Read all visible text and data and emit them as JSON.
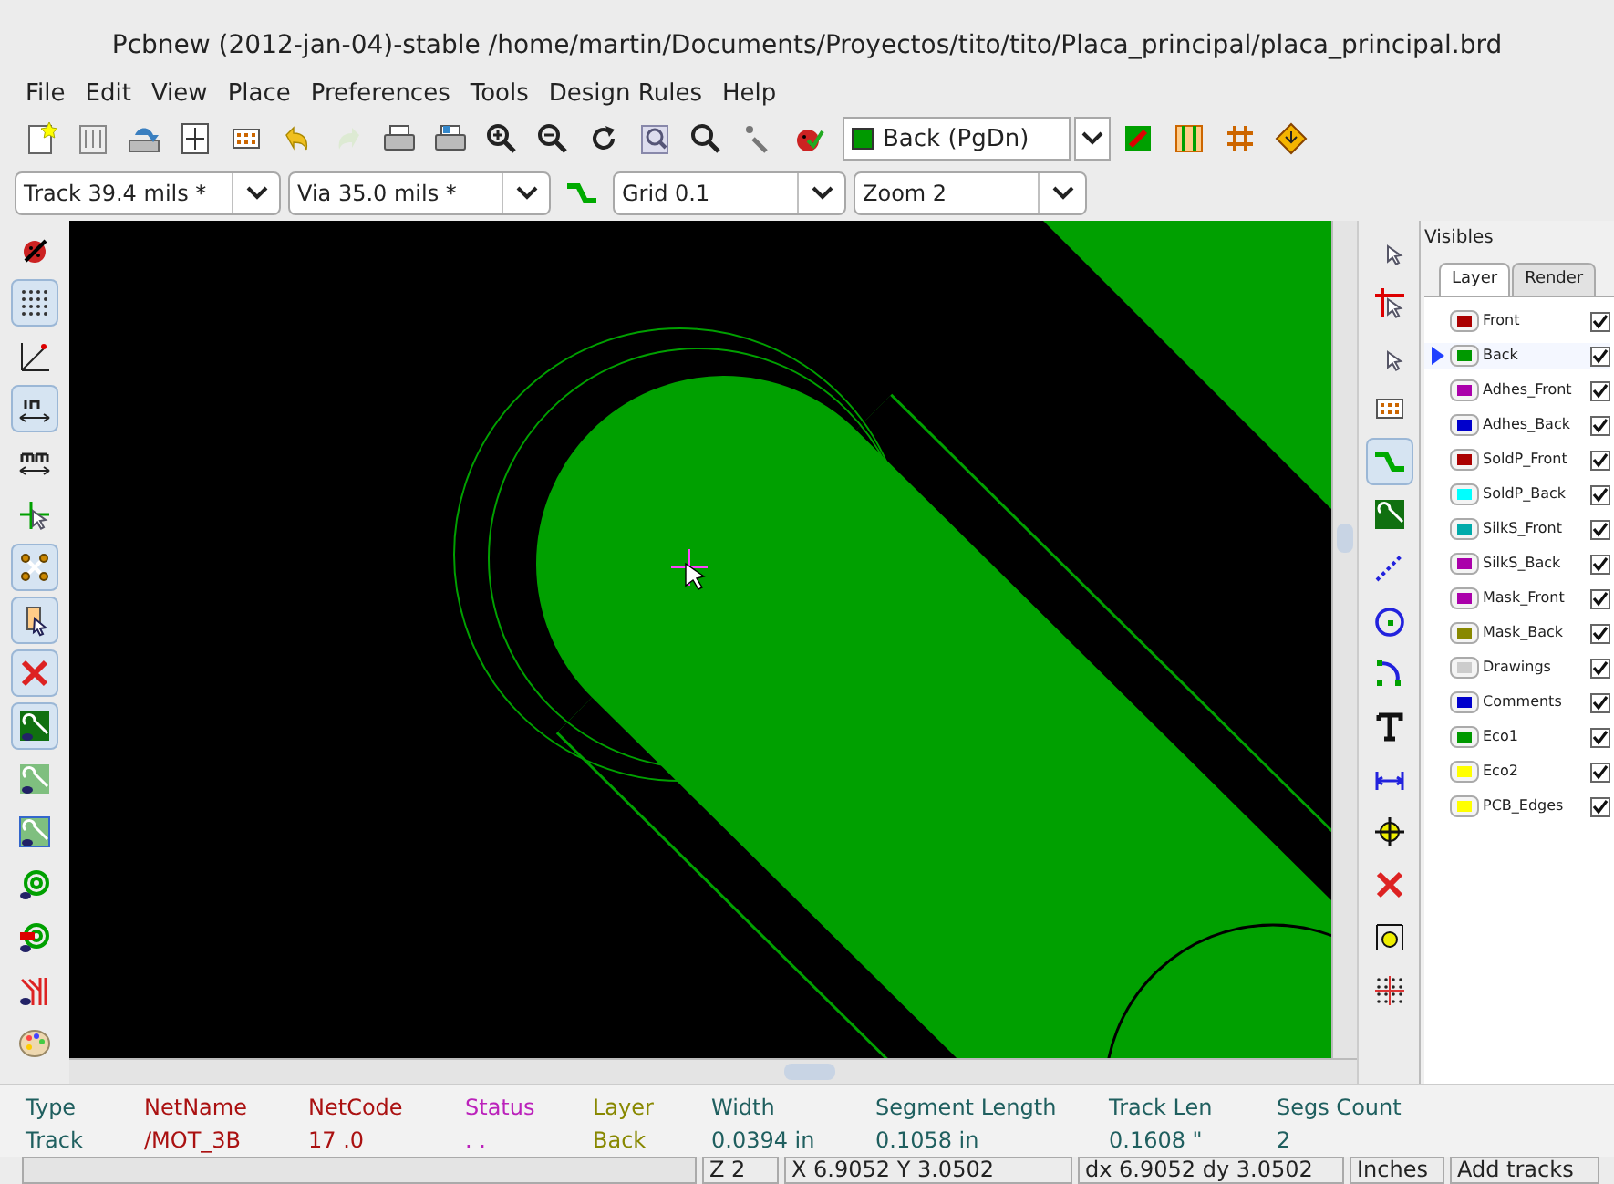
{
  "window": {
    "title": "Pcbnew (2012-jan-04)-stable /home/martin/Documents/Proyectos/tito/tito/Placa_principal/placa_principal.brd"
  },
  "menu": [
    "File",
    "Edit",
    "View",
    "Place",
    "Preferences",
    "Tools",
    "Design Rules",
    "Help"
  ],
  "main_toolbar": [
    {
      "kind": "new",
      "disabled": false
    },
    {
      "kind": "library",
      "disabled": false
    },
    {
      "kind": "save",
      "disabled": false
    },
    {
      "kind": "page",
      "disabled": false
    },
    {
      "kind": "module",
      "disabled": false
    },
    {
      "kind": "undo",
      "disabled": false
    },
    {
      "kind": "redo",
      "disabled": true
    },
    {
      "kind": "print",
      "disabled": false
    },
    {
      "kind": "plot",
      "disabled": false
    },
    {
      "kind": "zoom-in",
      "disabled": false
    },
    {
      "kind": "zoom-out",
      "disabled": false
    },
    {
      "kind": "redraw",
      "disabled": false
    },
    {
      "kind": "zoom-fit",
      "disabled": false
    },
    {
      "kind": "find",
      "disabled": false
    },
    {
      "kind": "netlist",
      "disabled": false
    },
    {
      "kind": "drc",
      "disabled": false
    }
  ],
  "layer_select": {
    "value": "Back (PgDn)",
    "color": "#009900"
  },
  "main_toolbar_end": [
    {
      "kind": "layer-pair",
      "disabled": false
    },
    {
      "kind": "placement",
      "disabled": false
    },
    {
      "kind": "router",
      "disabled": false
    },
    {
      "kind": "web",
      "disabled": false
    }
  ],
  "options_bar": {
    "track": "Track 39.4 mils *",
    "via": "Via 35.0 mils *",
    "grid": "Grid 0.1",
    "zoom": "Zoom 2"
  },
  "left_toolbar": [
    {
      "kind": "drc-off",
      "on": false
    },
    {
      "kind": "grid",
      "on": true
    },
    {
      "kind": "polar",
      "on": false
    },
    {
      "kind": "inches",
      "on": true
    },
    {
      "kind": "mm",
      "on": false
    },
    {
      "kind": "cursor",
      "on": false
    },
    {
      "kind": "ratsnest",
      "on": true
    },
    {
      "kind": "module-ratsnest",
      "on": true
    },
    {
      "kind": "delete",
      "on": true
    },
    {
      "kind": "zone-fill",
      "on": true
    },
    {
      "kind": "zone-outline",
      "on": false
    },
    {
      "kind": "zone-sketch",
      "on": false
    },
    {
      "kind": "pad-sketch",
      "on": false
    },
    {
      "kind": "via-sketch",
      "on": false
    },
    {
      "kind": "track-sketch",
      "on": false
    },
    {
      "kind": "palette",
      "on": false
    }
  ],
  "right_toolbar": [
    {
      "kind": "select",
      "selected": false
    },
    {
      "kind": "highlight",
      "selected": false
    },
    {
      "kind": "local-ratsnest",
      "selected": false
    },
    {
      "kind": "module",
      "selected": false
    },
    {
      "kind": "track",
      "selected": true
    },
    {
      "kind": "zone",
      "selected": false
    },
    {
      "kind": "line",
      "selected": false
    },
    {
      "kind": "circle",
      "selected": false
    },
    {
      "kind": "arc",
      "selected": false
    },
    {
      "kind": "text",
      "selected": false
    },
    {
      "kind": "dimension",
      "selected": false
    },
    {
      "kind": "target",
      "selected": false
    },
    {
      "kind": "delete",
      "selected": false
    },
    {
      "kind": "offset",
      "selected": false
    },
    {
      "kind": "grid-origin",
      "selected": false
    }
  ],
  "layers_panel": {
    "title": "Visibles",
    "tabs": [
      {
        "label": "Layer",
        "selected": true
      },
      {
        "label": "Render",
        "selected": false
      }
    ],
    "layers": [
      {
        "name": "Front",
        "color": "#aa0000",
        "checked": true,
        "selected": false
      },
      {
        "name": "Back",
        "color": "#009900",
        "checked": true,
        "selected": true
      },
      {
        "name": "Adhes_Front",
        "color": "#aa00aa",
        "checked": true,
        "selected": false
      },
      {
        "name": "Adhes_Back",
        "color": "#0000cc",
        "checked": true,
        "selected": false
      },
      {
        "name": "SoldP_Front",
        "color": "#aa0000",
        "checked": true,
        "selected": false
      },
      {
        "name": "SoldP_Back",
        "color": "#00ffff",
        "checked": true,
        "selected": false
      },
      {
        "name": "SilkS_Front",
        "color": "#00aaaa",
        "checked": true,
        "selected": false
      },
      {
        "name": "SilkS_Back",
        "color": "#aa00aa",
        "checked": true,
        "selected": false
      },
      {
        "name": "Mask_Front",
        "color": "#aa00aa",
        "checked": true,
        "selected": false
      },
      {
        "name": "Mask_Back",
        "color": "#888800",
        "checked": true,
        "selected": false
      },
      {
        "name": "Drawings",
        "color": "#cccccc",
        "checked": true,
        "selected": false
      },
      {
        "name": "Comments",
        "color": "#0000cc",
        "checked": true,
        "selected": false
      },
      {
        "name": "Eco1",
        "color": "#009900",
        "checked": true,
        "selected": false
      },
      {
        "name": "Eco2",
        "color": "#ffff00",
        "checked": true,
        "selected": false
      },
      {
        "name": "PCB_Edges",
        "color": "#ffff00",
        "checked": true,
        "selected": false
      }
    ]
  },
  "message_panel": [
    {
      "label": "Type",
      "value": "Track",
      "color": "#1f5f5f"
    },
    {
      "label": "NetName",
      "value": "/MOT_3B",
      "color": "#aa1111"
    },
    {
      "label": "NetCode",
      "value": "17 .0",
      "color": "#aa1111"
    },
    {
      "label": "Status",
      "value": ". .",
      "color": "#bb22bb"
    },
    {
      "label": "Layer",
      "value": "Back",
      "color": "#888800"
    },
    {
      "label": "Width",
      "value": "0.0394 in",
      "color": "#1f5f5f"
    },
    {
      "label": "Segment Length",
      "value": "0.1058 in",
      "color": "#1f5f5f"
    },
    {
      "label": "Track Len",
      "value": "0.1608 \"",
      "color": "#1f5f5f"
    },
    {
      "label": "Segs Count",
      "value": "2",
      "color": "#1f5f5f"
    }
  ],
  "status_bar": [
    "Z 2",
    "X 6.9052  Y 3.0502",
    "dx 6.9052  dy 3.0502",
    "Inches",
    "Add tracks"
  ]
}
